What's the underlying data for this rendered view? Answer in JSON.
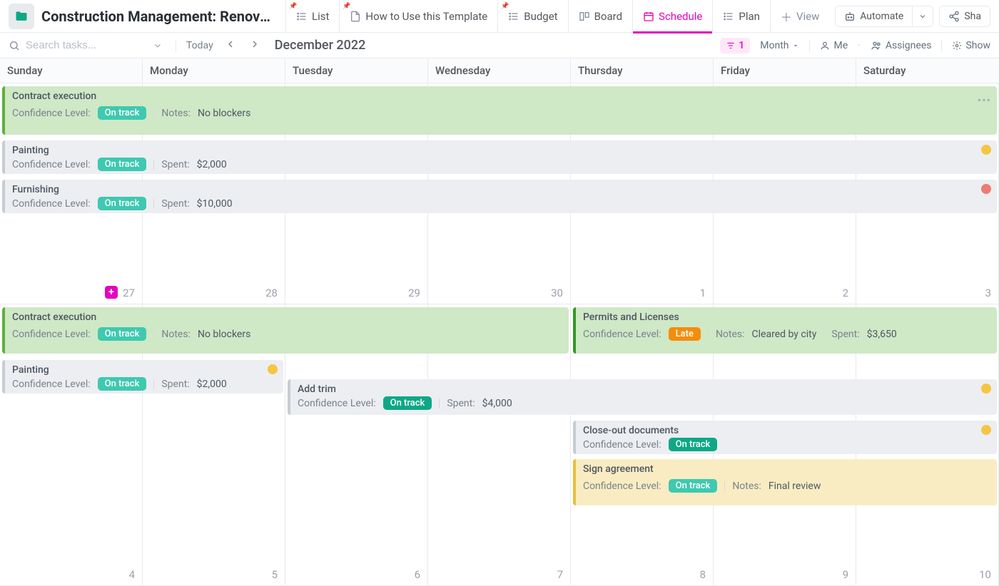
{
  "header": {
    "title": "Construction Management: Renovatio...",
    "tabs": [
      {
        "label": "List",
        "icon": "list"
      },
      {
        "label": "How to Use this Template",
        "icon": "doc"
      },
      {
        "label": "Budget",
        "icon": "list"
      },
      {
        "label": "Board",
        "icon": "board"
      },
      {
        "label": "Schedule",
        "icon": "calendar",
        "active": true
      },
      {
        "label": "Plan",
        "icon": "list"
      }
    ],
    "add_view": "View",
    "automate": "Automate",
    "share": "Sha"
  },
  "toolbar": {
    "search_placeholder": "Search tasks...",
    "today": "Today",
    "month_label": "December 2022",
    "filter_count": "1",
    "scale_label": "Month",
    "me": "Me",
    "assignees": "Assignees",
    "show": "Show"
  },
  "days": [
    "Sunday",
    "Monday",
    "Tuesday",
    "Wednesday",
    "Thursday",
    "Friday",
    "Saturday"
  ],
  "weeks": [
    {
      "dates": [
        "27",
        "28",
        "29",
        "30",
        "1",
        "2",
        "3"
      ],
      "hover_col": 0
    },
    {
      "dates": [
        "4",
        "5",
        "6",
        "7",
        "8",
        "9",
        "10"
      ]
    }
  ],
  "events": {
    "w0": {
      "contract": {
        "title": "Contract execution",
        "conf_label": "Confidence Level:",
        "conf": "On track",
        "notes_label": "Notes:",
        "notes": "No blockers"
      },
      "painting": {
        "title": "Painting",
        "conf_label": "Confidence Level:",
        "conf": "On track",
        "spent_label": "Spent:",
        "spent": "$2,000"
      },
      "furnish": {
        "title": "Furnishing",
        "conf_label": "Confidence Level:",
        "conf": "On track",
        "spent_label": "Spent:",
        "spent": "$10,000"
      }
    },
    "w1": {
      "contract": {
        "title": "Contract execution",
        "conf_label": "Confidence Level:",
        "conf": "On track",
        "notes_label": "Notes:",
        "notes": "No blockers"
      },
      "permits": {
        "title": "Permits and Licenses",
        "conf_label": "Confidence Level:",
        "conf": "Late",
        "notes_label": "Notes:",
        "notes": "Cleared by city",
        "spent_label": "Spent:",
        "spent": "$3,650"
      },
      "painting": {
        "title": "Painting",
        "conf_label": "Confidence Level:",
        "conf": "On track",
        "spent_label": "Spent:",
        "spent": "$2,000"
      },
      "trim": {
        "title": "Add trim",
        "conf_label": "Confidence Level:",
        "conf": "On track",
        "spent_label": "Spent:",
        "spent": "$4,000"
      },
      "closeout": {
        "title": "Close-out documents",
        "conf_label": "Confidence Level:",
        "conf": "On track"
      },
      "sign": {
        "title": "Sign agreement",
        "conf_label": "Confidence Level:",
        "conf": "On track",
        "notes_label": "Notes:",
        "notes": "Final review"
      }
    }
  }
}
